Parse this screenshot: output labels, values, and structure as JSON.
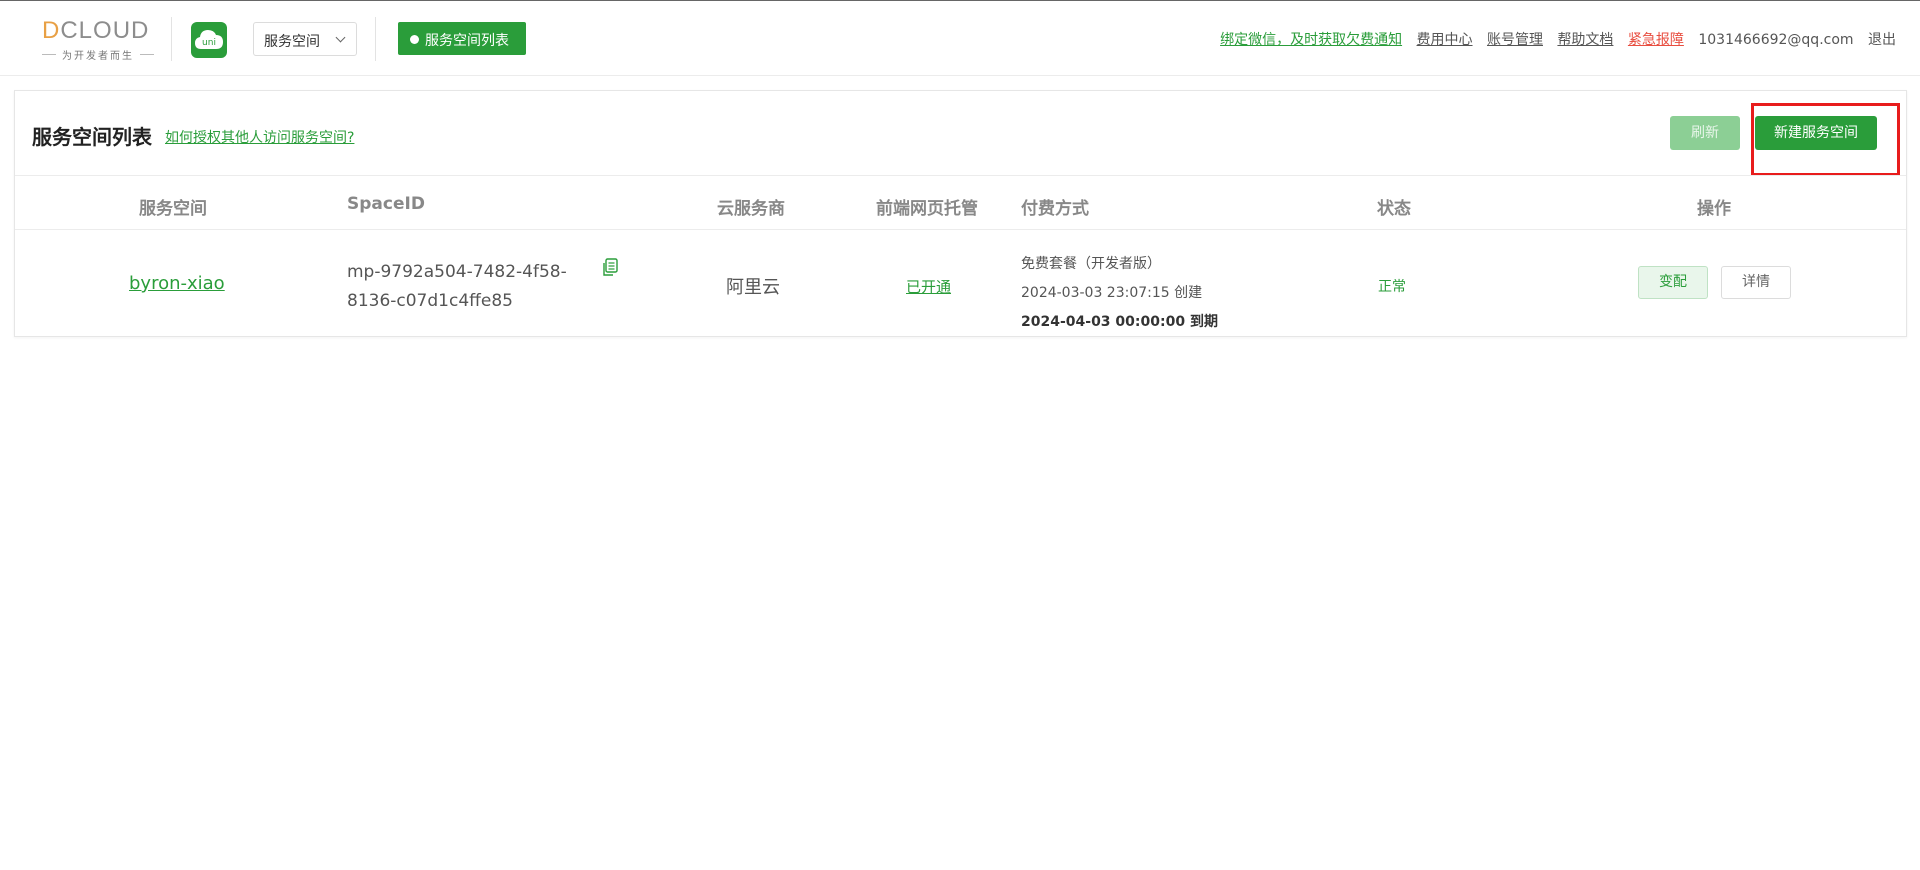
{
  "header": {
    "logo_text": "DCLOUD",
    "logo_subtitle": "为开发者而生",
    "app_icon": "uni-cloud-icon",
    "app_icon_text": "uni",
    "space_select": "服务空间",
    "active_tab": "服务空间列表",
    "links": {
      "wechat_notify": "绑定微信，及时获取欠费通知",
      "billing": "费用中心",
      "account": "账号管理",
      "docs": "帮助文档",
      "emergency": "紧急报障",
      "email": "1031466692@qq.com",
      "logout": "退出"
    }
  },
  "card": {
    "title": "服务空间列表",
    "help_link": "如何授权其他人访问服务空间?",
    "refresh_label": "刷新",
    "new_label": "新建服务空间"
  },
  "table": {
    "columns": [
      "服务空间",
      "SpaceID",
      "云服务商",
      "前端网页托管",
      "付费方式",
      "状态",
      "操作"
    ],
    "rows": [
      {
        "name": "byron-xiao",
        "space_id_line1": "mp-9792a504-7482-4f58-",
        "space_id_line2": "8136-c07d1c4ffe85",
        "provider": "阿里云",
        "hosting": "已开通",
        "plan": "免费套餐（开发者版）",
        "created": "2024-03-03 23:07:15 创建",
        "expires": "2024-04-03 00:00:00 到期",
        "status": "正常",
        "action_config": "变配",
        "action_detail": "详情"
      }
    ]
  },
  "colors": {
    "primary": "#2a9d3a",
    "danger": "#e84e40",
    "highlight_box": "#e81c1c"
  }
}
